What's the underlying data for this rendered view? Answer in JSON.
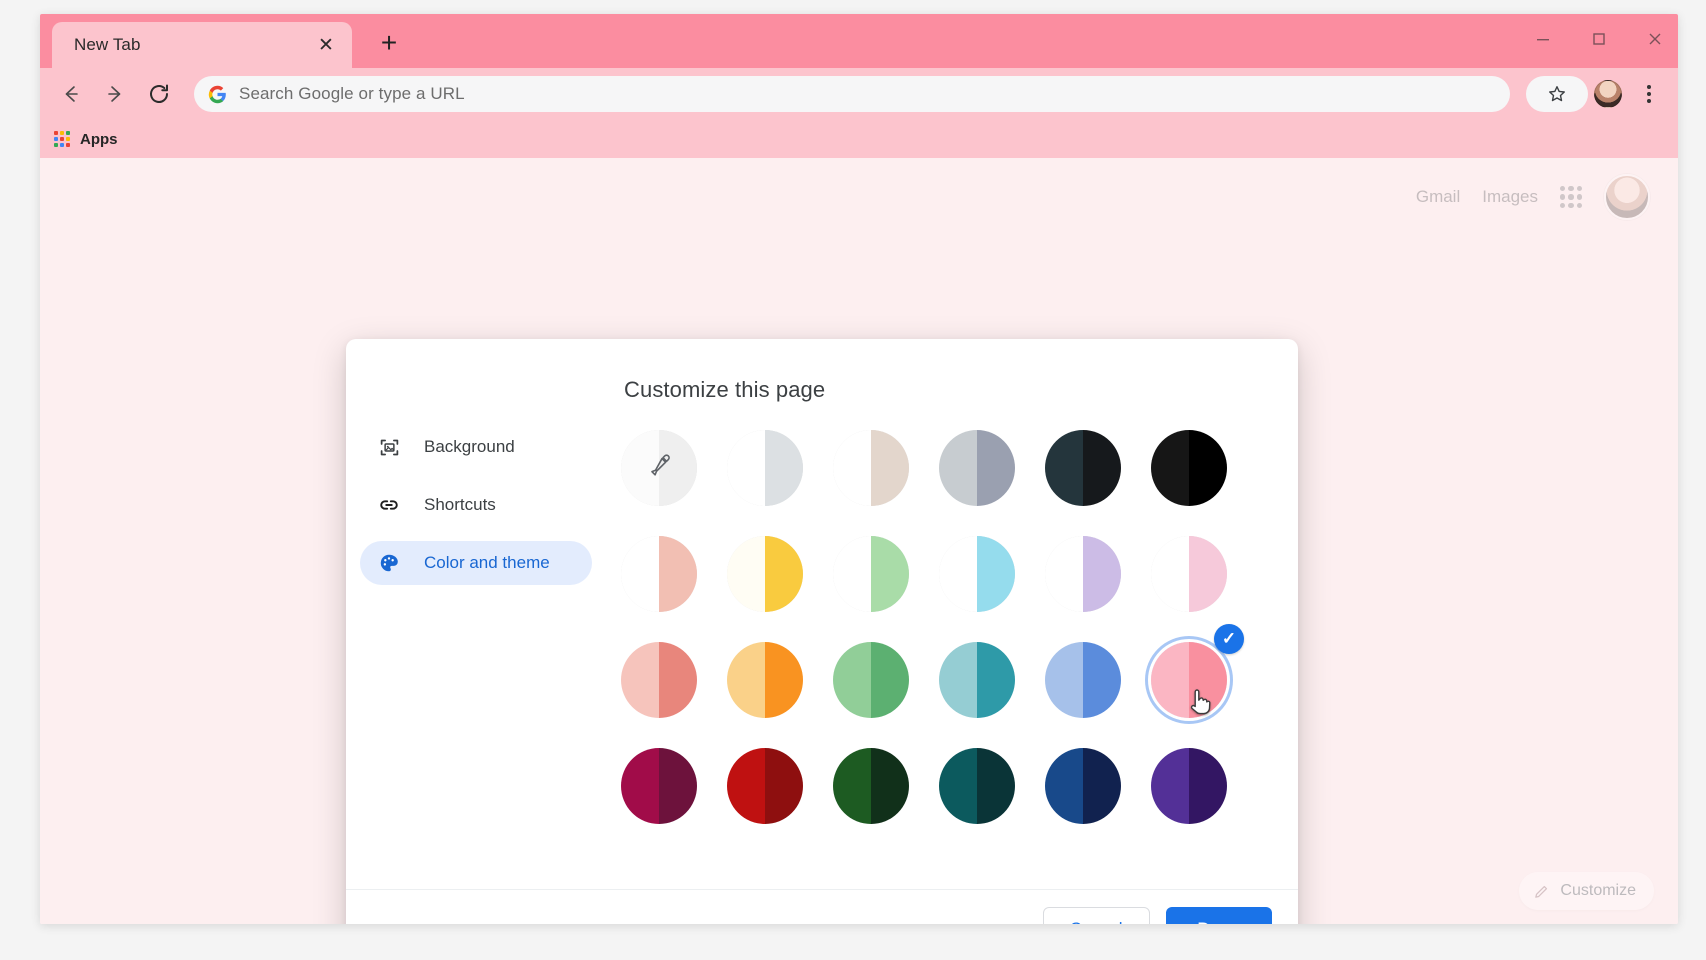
{
  "window": {
    "controls": [
      {
        "name": "minimize",
        "glyph": "—"
      },
      {
        "name": "maximize",
        "glyph": "☐"
      },
      {
        "name": "close",
        "glyph": "✕"
      }
    ],
    "chrome_tabstrip_color": "#fb8da0",
    "chrome_toolbar_color": "#fcc4cd",
    "page_background_color": "#fdeff0"
  },
  "tab": {
    "title": "New Tab",
    "close_glyph": "✕",
    "new_tab_glyph": "+"
  },
  "toolbar": {
    "back_glyph": "←",
    "forward_glyph": "→",
    "reload_glyph": "↻",
    "omnibox_placeholder": "Search Google or type a URL",
    "omnibox_value": "",
    "star_glyph": "☆",
    "kebab_label": ""
  },
  "bookmarks": {
    "apps_label": "Apps"
  },
  "new_tab_page": {
    "links": [
      "Gmail",
      "Images"
    ],
    "customize_label": "Customize",
    "customize_icon": "pencil-icon"
  },
  "dialog": {
    "title": "Customize this page",
    "menu": [
      {
        "label": "Background",
        "icon": "image-frame-icon",
        "selected": false
      },
      {
        "label": "Shortcuts",
        "icon": "link-icon",
        "selected": false
      },
      {
        "label": "Color and theme",
        "icon": "palette-icon",
        "selected": true
      }
    ],
    "accent_color": "#1a73e8",
    "selected_menu_bg": "#e3ecfd",
    "footer": {
      "cancel_label": "Cancel",
      "done_label": "Done"
    },
    "swatches": [
      {
        "name": "custom-color-picker",
        "left": "#fbfbfb",
        "right": "#efefef",
        "outlined": true,
        "eyedropper": true,
        "selected": false
      },
      {
        "name": "grey-light",
        "left": "#ffffff",
        "right": "#dce0e3",
        "outlined": true,
        "selected": false
      },
      {
        "name": "beige-light",
        "left": "#ffffff",
        "right": "#e3d6cc",
        "outlined": true,
        "selected": false
      },
      {
        "name": "grey-blue",
        "left": "#c7ccd0",
        "right": "#9aa0b0",
        "outlined": false,
        "selected": false
      },
      {
        "name": "dark-slate",
        "left": "#24353c",
        "right": "#16191c",
        "outlined": false,
        "selected": false
      },
      {
        "name": "black",
        "left": "#161616",
        "right": "#000000",
        "outlined": false,
        "selected": false
      },
      {
        "name": "pale-salmon",
        "left": "#ffffff",
        "right": "#f2bfb3",
        "outlined": true,
        "selected": false
      },
      {
        "name": "pale-yellow",
        "left": "#fffdf4",
        "right": "#f9cb3f",
        "outlined": true,
        "selected": false
      },
      {
        "name": "pale-green",
        "left": "#ffffff",
        "right": "#a9dca8",
        "outlined": true,
        "selected": false
      },
      {
        "name": "pale-cyan",
        "left": "#ffffff",
        "right": "#95dced",
        "outlined": true,
        "selected": false
      },
      {
        "name": "pale-lavender",
        "left": "#ffffff",
        "right": "#ccbce6",
        "outlined": true,
        "selected": false
      },
      {
        "name": "pale-pink",
        "left": "#ffffff",
        "right": "#f6c9da",
        "outlined": true,
        "selected": false
      },
      {
        "name": "salmon",
        "left": "#f6c4bc",
        "right": "#e8867c",
        "outlined": false,
        "selected": false
      },
      {
        "name": "orange",
        "left": "#fad189",
        "right": "#f99321",
        "outlined": false,
        "selected": false
      },
      {
        "name": "green",
        "left": "#91ce98",
        "right": "#5cb071",
        "outlined": false,
        "selected": false
      },
      {
        "name": "teal",
        "left": "#95cdd3",
        "right": "#2e9aa8",
        "outlined": false,
        "selected": false
      },
      {
        "name": "blue",
        "left": "#a6c1ea",
        "right": "#5b8cdc",
        "outlined": false,
        "selected": false
      },
      {
        "name": "pink",
        "left": "#fbb6c3",
        "right": "#f9909f",
        "outlined": false,
        "selected": true
      },
      {
        "name": "crimson",
        "left": "#a10c49",
        "right": "#6d123c",
        "outlined": false,
        "selected": false
      },
      {
        "name": "red",
        "left": "#bf1111",
        "right": "#8e0f0f",
        "outlined": false,
        "selected": false
      },
      {
        "name": "dark-green",
        "left": "#1d5b22",
        "right": "#11301a",
        "outlined": false,
        "selected": false
      },
      {
        "name": "dark-teal",
        "left": "#0c5a5e",
        "right": "#0a3437",
        "outlined": false,
        "selected": false
      },
      {
        "name": "navy",
        "left": "#18498a",
        "right": "#11224f",
        "outlined": false,
        "selected": false
      },
      {
        "name": "purple",
        "left": "#533097",
        "right": "#331663",
        "outlined": false,
        "selected": false
      }
    ],
    "selected_swatch_index": 17,
    "check_glyph": "✓"
  }
}
